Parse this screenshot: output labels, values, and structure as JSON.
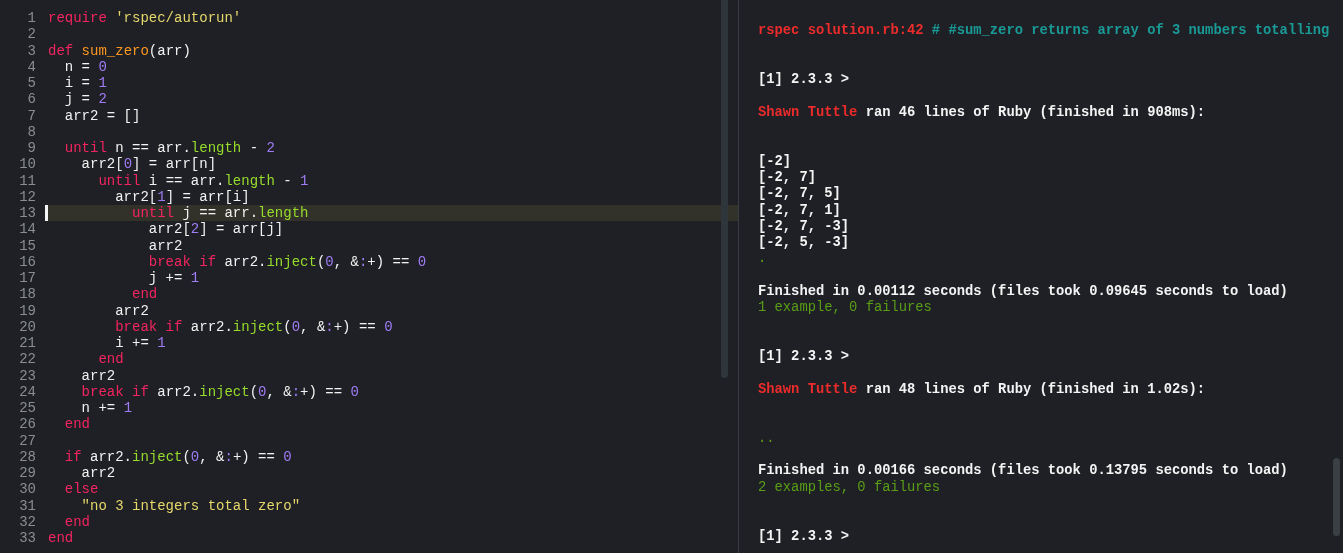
{
  "editor": {
    "lines": [
      {
        "number": "1",
        "current": false,
        "tokens": [
          {
            "kind": "keyword",
            "text": "require"
          },
          {
            "kind": "string",
            "text": " 'rspec/autorun'"
          }
        ]
      },
      {
        "number": "2",
        "current": false
      },
      {
        "number": "3",
        "current": false,
        "tokens": [
          {
            "kind": "keyword",
            "text": "def"
          },
          {
            "kind": "function",
            "text": " sum_zero"
          },
          {
            "kind": "plain",
            "text": "(arr)"
          }
        ]
      },
      {
        "number": "4",
        "current": false,
        "tokens": [
          {
            "kind": "plain",
            "text": "  n = "
          },
          {
            "kind": "number",
            "text": "0"
          }
        ]
      },
      {
        "number": "5",
        "current": false,
        "tokens": [
          {
            "kind": "plain",
            "text": "  i = "
          },
          {
            "kind": "number",
            "text": "1"
          }
        ]
      },
      {
        "number": "6",
        "current": false,
        "tokens": [
          {
            "kind": "plain",
            "text": "  j = "
          },
          {
            "kind": "number",
            "text": "2"
          }
        ]
      },
      {
        "number": "7",
        "current": false,
        "tokens": [
          {
            "kind": "plain",
            "text": "  arr2 = []"
          }
        ]
      },
      {
        "number": "8",
        "current": false
      },
      {
        "number": "9",
        "current": false,
        "tokens": [
          {
            "kind": "keyword",
            "text": "  until"
          },
          {
            "kind": "plain",
            "text": " n == arr."
          },
          {
            "kind": "method",
            "text": "length"
          },
          {
            "kind": "plain",
            "text": " - "
          },
          {
            "kind": "number",
            "text": "2"
          }
        ]
      },
      {
        "number": "10",
        "current": false,
        "tokens": [
          {
            "kind": "plain",
            "text": "    arr2["
          },
          {
            "kind": "number",
            "text": "0"
          },
          {
            "kind": "plain",
            "text": "] = arr[n]"
          }
        ]
      },
      {
        "number": "11",
        "current": false,
        "tokens": [
          {
            "kind": "keyword",
            "text": "      until"
          },
          {
            "kind": "plain",
            "text": " i == arr."
          },
          {
            "kind": "method",
            "text": "length"
          },
          {
            "kind": "plain",
            "text": " - "
          },
          {
            "kind": "number",
            "text": "1"
          }
        ]
      },
      {
        "number": "12",
        "current": false,
        "tokens": [
          {
            "kind": "plain",
            "text": "        arr2["
          },
          {
            "kind": "number",
            "text": "1"
          },
          {
            "kind": "plain",
            "text": "] = arr[i]"
          }
        ]
      },
      {
        "number": "13",
        "current": true,
        "tokens": [
          {
            "kind": "keyword",
            "text": "          until"
          },
          {
            "kind": "plain",
            "text": " j == arr."
          },
          {
            "kind": "method",
            "text": "length"
          }
        ]
      },
      {
        "number": "14",
        "current": false,
        "tokens": [
          {
            "kind": "plain",
            "text": "            arr2["
          },
          {
            "kind": "number",
            "text": "2"
          },
          {
            "kind": "plain",
            "text": "] = arr[j]"
          }
        ]
      },
      {
        "number": "15",
        "current": false,
        "tokens": [
          {
            "kind": "plain",
            "text": "            arr2"
          }
        ]
      },
      {
        "number": "16",
        "current": false,
        "tokens": [
          {
            "kind": "keyword",
            "text": "            break if"
          },
          {
            "kind": "plain",
            "text": " arr2."
          },
          {
            "kind": "method",
            "text": "inject"
          },
          {
            "kind": "plain",
            "text": "("
          },
          {
            "kind": "number",
            "text": "0"
          },
          {
            "kind": "plain",
            "text": ", &"
          },
          {
            "kind": "number",
            "text": ":"
          },
          {
            "kind": "plain",
            "text": "+) == "
          },
          {
            "kind": "number",
            "text": "0"
          }
        ]
      },
      {
        "number": "17",
        "current": false,
        "tokens": [
          {
            "kind": "plain",
            "text": "            j += "
          },
          {
            "kind": "number",
            "text": "1"
          }
        ]
      },
      {
        "number": "18",
        "current": false,
        "tokens": [
          {
            "kind": "keyword",
            "text": "          end"
          }
        ]
      },
      {
        "number": "19",
        "current": false,
        "tokens": [
          {
            "kind": "plain",
            "text": "        arr2"
          }
        ]
      },
      {
        "number": "20",
        "current": false,
        "tokens": [
          {
            "kind": "keyword",
            "text": "        break if"
          },
          {
            "kind": "plain",
            "text": " arr2."
          },
          {
            "kind": "method",
            "text": "inject"
          },
          {
            "kind": "plain",
            "text": "("
          },
          {
            "kind": "number",
            "text": "0"
          },
          {
            "kind": "plain",
            "text": ", &"
          },
          {
            "kind": "number",
            "text": ":"
          },
          {
            "kind": "plain",
            "text": "+) == "
          },
          {
            "kind": "number",
            "text": "0"
          }
        ]
      },
      {
        "number": "21",
        "current": false,
        "tokens": [
          {
            "kind": "plain",
            "text": "        i += "
          },
          {
            "kind": "number",
            "text": "1"
          }
        ]
      },
      {
        "number": "22",
        "current": false,
        "tokens": [
          {
            "kind": "keyword",
            "text": "      end"
          }
        ]
      },
      {
        "number": "23",
        "current": false,
        "tokens": [
          {
            "kind": "plain",
            "text": "    arr2"
          }
        ]
      },
      {
        "number": "24",
        "current": false,
        "tokens": [
          {
            "kind": "keyword",
            "text": "    break if"
          },
          {
            "kind": "plain",
            "text": " arr2."
          },
          {
            "kind": "method",
            "text": "inject"
          },
          {
            "kind": "plain",
            "text": "("
          },
          {
            "kind": "number",
            "text": "0"
          },
          {
            "kind": "plain",
            "text": ", &"
          },
          {
            "kind": "number",
            "text": ":"
          },
          {
            "kind": "plain",
            "text": "+) == "
          },
          {
            "kind": "number",
            "text": "0"
          }
        ]
      },
      {
        "number": "25",
        "current": false,
        "tokens": [
          {
            "kind": "plain",
            "text": "    n += "
          },
          {
            "kind": "number",
            "text": "1"
          }
        ]
      },
      {
        "number": "26",
        "current": false,
        "tokens": [
          {
            "kind": "keyword",
            "text": "  end"
          }
        ]
      },
      {
        "number": "27",
        "current": false
      },
      {
        "number": "28",
        "current": false,
        "tokens": [
          {
            "kind": "keyword",
            "text": "  if"
          },
          {
            "kind": "plain",
            "text": " arr2."
          },
          {
            "kind": "method",
            "text": "inject"
          },
          {
            "kind": "plain",
            "text": "("
          },
          {
            "kind": "number",
            "text": "0"
          },
          {
            "kind": "plain",
            "text": ", &"
          },
          {
            "kind": "number",
            "text": ":"
          },
          {
            "kind": "plain",
            "text": "+) == "
          },
          {
            "kind": "number",
            "text": "0"
          }
        ]
      },
      {
        "number": "29",
        "current": false,
        "tokens": [
          {
            "kind": "plain",
            "text": "    arr2"
          }
        ]
      },
      {
        "number": "30",
        "current": false,
        "tokens": [
          {
            "kind": "keyword",
            "text": "  else"
          }
        ]
      },
      {
        "number": "31",
        "current": false,
        "tokens": [
          {
            "kind": "string",
            "text": "    \"no 3 integers total zero\""
          }
        ]
      },
      {
        "number": "32",
        "current": false,
        "tokens": [
          {
            "kind": "keyword",
            "text": "  end"
          }
        ]
      },
      {
        "number": "33",
        "current": false,
        "tokens": [
          {
            "kind": "keyword",
            "text": "end"
          }
        ]
      }
    ]
  },
  "terminal": {
    "lines": [
      {
        "kind": "blank"
      },
      {
        "kind": "text",
        "spans": [
          {
            "kind": "error",
            "text": "rspec solution.rb:42"
          },
          {
            "kind": "comment",
            "text": " # #sum_zero returns array of 3 numbers totalling"
          }
        ]
      },
      {
        "kind": "blank"
      },
      {
        "kind": "blank"
      },
      {
        "kind": "text",
        "spans": [
          {
            "kind": "plain",
            "text": "[1] 2.3.3 >"
          }
        ]
      },
      {
        "kind": "blank"
      },
      {
        "kind": "text",
        "spans": [
          {
            "kind": "error",
            "text": "Shawn Tuttle"
          },
          {
            "kind": "plain",
            "text": " ran 46 lines of Ruby (finished in 908ms):"
          }
        ]
      },
      {
        "kind": "blank"
      },
      {
        "kind": "blank"
      },
      {
        "kind": "text",
        "spans": [
          {
            "kind": "plain",
            "text": "[-2]"
          }
        ]
      },
      {
        "kind": "text",
        "spans": [
          {
            "kind": "plain",
            "text": "[-2, 7]"
          }
        ]
      },
      {
        "kind": "text",
        "spans": [
          {
            "kind": "plain",
            "text": "[-2, 7, 5]"
          }
        ]
      },
      {
        "kind": "text",
        "spans": [
          {
            "kind": "plain",
            "text": "[-2, 7, 1]"
          }
        ]
      },
      {
        "kind": "text",
        "spans": [
          {
            "kind": "plain",
            "text": "[-2, 7, -3]"
          }
        ]
      },
      {
        "kind": "text",
        "spans": [
          {
            "kind": "plain",
            "text": "[-2, 5, -3]"
          }
        ]
      },
      {
        "kind": "text",
        "spans": [
          {
            "kind": "success",
            "text": "."
          }
        ]
      },
      {
        "kind": "blank"
      },
      {
        "kind": "text",
        "spans": [
          {
            "kind": "plain",
            "text": "Finished in 0.00112 seconds (files took 0.09645 seconds to load)"
          }
        ]
      },
      {
        "kind": "text",
        "spans": [
          {
            "kind": "success",
            "text": "1 example, 0 failures"
          }
        ]
      },
      {
        "kind": "blank"
      },
      {
        "kind": "blank"
      },
      {
        "kind": "text",
        "spans": [
          {
            "kind": "plain",
            "text": "[1] 2.3.3 >"
          }
        ]
      },
      {
        "kind": "blank"
      },
      {
        "kind": "text",
        "spans": [
          {
            "kind": "error",
            "text": "Shawn Tuttle"
          },
          {
            "kind": "plain",
            "text": " ran 48 lines of Ruby (finished in 1.02s):"
          }
        ]
      },
      {
        "kind": "blank"
      },
      {
        "kind": "blank"
      },
      {
        "kind": "text",
        "spans": [
          {
            "kind": "success",
            "text": ".."
          }
        ]
      },
      {
        "kind": "blank"
      },
      {
        "kind": "text",
        "spans": [
          {
            "kind": "plain",
            "text": "Finished in 0.00166 seconds (files took 0.13795 seconds to load)"
          }
        ]
      },
      {
        "kind": "text",
        "spans": [
          {
            "kind": "success",
            "text": "2 examples, 0 failures"
          }
        ]
      },
      {
        "kind": "blank"
      },
      {
        "kind": "blank"
      },
      {
        "kind": "text",
        "spans": [
          {
            "kind": "plain",
            "text": "[1] 2.3.3 >"
          }
        ]
      }
    ]
  }
}
